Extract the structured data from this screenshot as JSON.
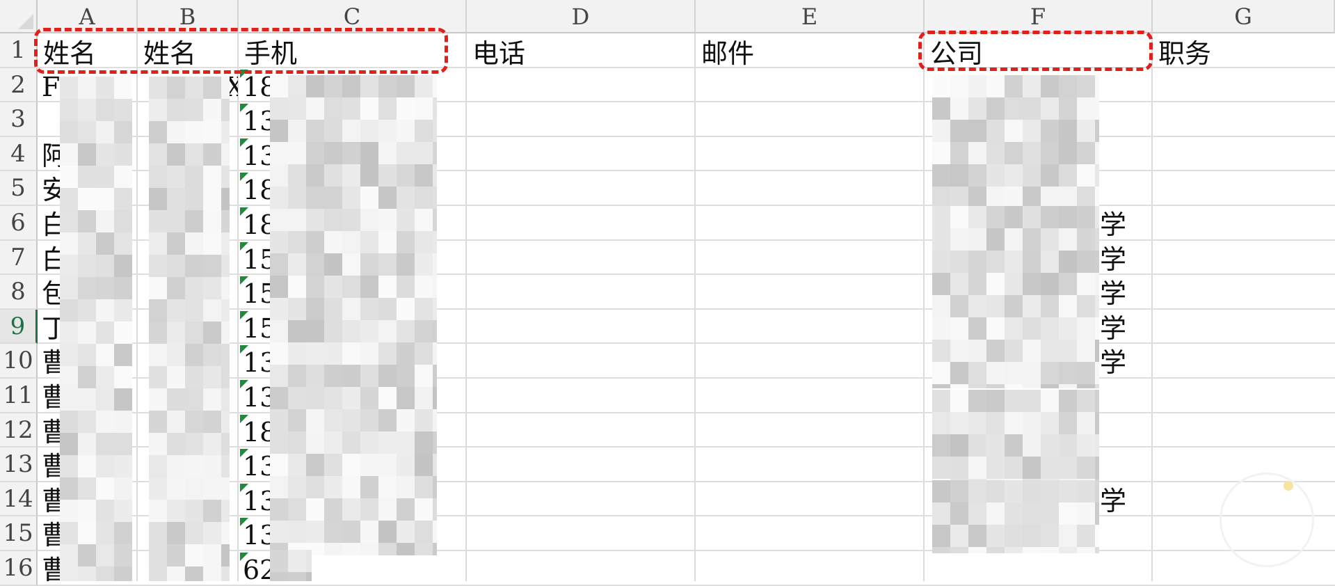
{
  "columns": [
    "A",
    "B",
    "C",
    "D",
    "E",
    "F",
    "G"
  ],
  "header_row": {
    "A": "姓名",
    "B": "姓名",
    "C": "手机",
    "D": "电话",
    "E": "邮件",
    "F": "公司",
    "G": "职务"
  },
  "rows": [
    {
      "n": "1"
    },
    {
      "n": "2",
      "a": "F",
      "c": "18",
      "a_cut": "X"
    },
    {
      "n": "3",
      "a": "",
      "c": "13"
    },
    {
      "n": "4",
      "a": "阿",
      "c": "13"
    },
    {
      "n": "5",
      "a": "安",
      "c": "18"
    },
    {
      "n": "6",
      "a": "白",
      "c": "18",
      "g_suffix": "学"
    },
    {
      "n": "7",
      "a": "白",
      "c": "15",
      "g_suffix": "学"
    },
    {
      "n": "8",
      "a": "包",
      "c": "15",
      "g_suffix": "学"
    },
    {
      "n": "9",
      "a": "丁",
      "c": "15",
      "g_suffix": "学"
    },
    {
      "n": "10",
      "a": "曹",
      "c": "13",
      "g_suffix": "学"
    },
    {
      "n": "11",
      "a": "曹",
      "c": "13"
    },
    {
      "n": "12",
      "a": "曹",
      "c": "18"
    },
    {
      "n": "13",
      "a": "曹",
      "c": "13"
    },
    {
      "n": "14",
      "a": "曹",
      "c": "13",
      "g_suffix": "学"
    },
    {
      "n": "15",
      "a": "曹",
      "c": "13"
    },
    {
      "n": "16",
      "a": "曹",
      "c": "62"
    }
  ],
  "active_row": "9",
  "colors": {
    "highlight": "#e0201b",
    "error_triangle": "#1f8a3a",
    "active_row_header": "#217346"
  }
}
